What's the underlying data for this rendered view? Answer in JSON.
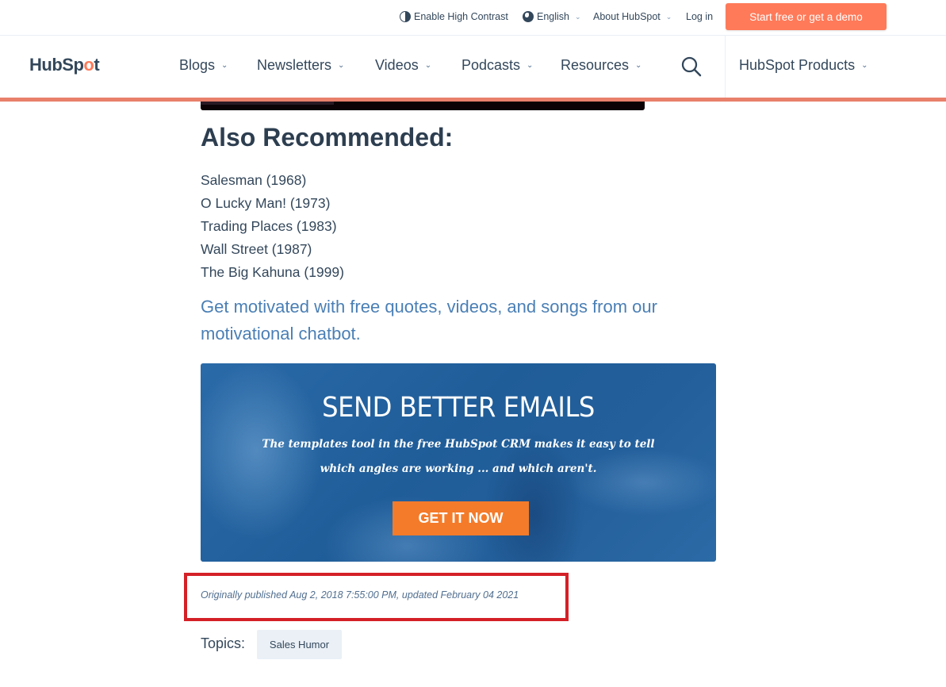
{
  "utility_bar": {
    "high_contrast_label": "Enable High Contrast",
    "language_label": "English",
    "about_label": "About HubSpot",
    "login_label": "Log in",
    "cta_label": "Start free or get a demo"
  },
  "nav": {
    "logo_prefix": "HubSp",
    "logo_o": "o",
    "logo_suffix": "t",
    "items": [
      {
        "label": "Blogs"
      },
      {
        "label": "Newsletters"
      },
      {
        "label": "Videos"
      },
      {
        "label": "Podcasts"
      },
      {
        "label": "Resources"
      }
    ],
    "products_label": "HubSpot Products",
    "chevron": "⌄"
  },
  "video": {
    "progress_fraction": 0.3
  },
  "content": {
    "recommended_title": "Also Recommended:",
    "recommended_items": [
      "Salesman (1968)",
      "O Lucky Man! (1973)",
      "Trading Places (1983)",
      "Wall Street (1987)",
      "The Big Kahuna (1999)"
    ],
    "motivate_link": "Get motivated with free quotes, videos, and songs from our motivational chatbot."
  },
  "banner": {
    "title": "SEND BETTER EMAILS",
    "subtitle_line1": "The templates tool in the free HubSpot CRM makes it easy to tell",
    "subtitle_line2": "which angles are working ... and which aren't.",
    "button_label": "GET IT NOW"
  },
  "meta": {
    "published": "Originally published Aug 2, 2018 7:55:00 PM, updated February 04 2021",
    "topics_label": "Topics:",
    "topics": [
      "Sales Humor"
    ]
  },
  "colors": {
    "brand_orange": "#ff7a59",
    "nav_accent": "#e8806b",
    "link_blue": "#4a7fb5",
    "banner_button": "#f47b2a",
    "highlight_red": "#d42027"
  }
}
